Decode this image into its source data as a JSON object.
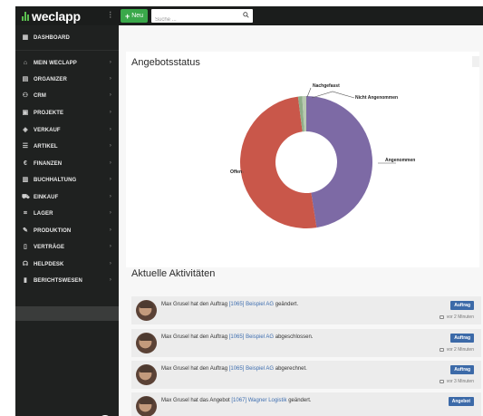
{
  "topbar": {
    "logo": "weclapp",
    "menu_toggle": "⁝",
    "new_label": "Neu",
    "search_placeholder": "Suche ..."
  },
  "sidebar": {
    "items": [
      {
        "label": "Dashboard",
        "icon": "dashboard-icon",
        "glyph": "▦",
        "chevron": false
      },
      {
        "label": "Mein weclapp",
        "icon": "home-icon",
        "glyph": "⌂",
        "chevron": true
      },
      {
        "label": "Organizer",
        "icon": "calendar-icon",
        "glyph": "▤",
        "chevron": true
      },
      {
        "label": "CRM",
        "icon": "users-icon",
        "glyph": "⚇",
        "chevron": true
      },
      {
        "label": "Projekte",
        "icon": "briefcase-icon",
        "glyph": "▣",
        "chevron": true
      },
      {
        "label": "Verkauf",
        "icon": "tag-icon",
        "glyph": "◈",
        "chevron": true
      },
      {
        "label": "Artikel",
        "icon": "list-icon",
        "glyph": "☰",
        "chevron": true
      },
      {
        "label": "Finanzen",
        "icon": "euro-icon",
        "glyph": "€",
        "chevron": true
      },
      {
        "label": "Buchhaltung",
        "icon": "ledger-icon",
        "glyph": "▥",
        "chevron": true
      },
      {
        "label": "Einkauf",
        "icon": "cart-icon",
        "glyph": "⛟",
        "chevron": true
      },
      {
        "label": "Lager",
        "icon": "warehouse-icon",
        "glyph": "⌗",
        "chevron": true
      },
      {
        "label": "Produktion",
        "icon": "wrench-icon",
        "glyph": "✎",
        "chevron": true
      },
      {
        "label": "Verträge",
        "icon": "document-icon",
        "glyph": "▯",
        "chevron": true
      },
      {
        "label": "Helpdesk",
        "icon": "headset-icon",
        "glyph": "☊",
        "chevron": true
      },
      {
        "label": "Berichtswesen",
        "icon": "bar-chart-icon",
        "glyph": "▮",
        "chevron": true
      }
    ],
    "collapse_glyph": "‹"
  },
  "main": {
    "status_title": "Angebotsstatus",
    "activities_title": "Aktuelle Aktivitäten",
    "activities": [
      {
        "prefix": "Max Grusel hat den Auftrag ",
        "link": "[1065] Beispiel AG",
        "suffix": " geändert.",
        "badge": "Auftrag",
        "time": "vor 2 Minuten"
      },
      {
        "prefix": "Max Grusel hat den Auftrag ",
        "link": "[1065] Beispiel AG",
        "suffix": " abgeschlossen.",
        "badge": "Auftrag",
        "time": "vor 2 Minuten"
      },
      {
        "prefix": "Max Grusel hat den Auftrag ",
        "link": "[1065] Beispiel AG",
        "suffix": " abgerechnet.",
        "badge": "Auftrag",
        "time": "vor 3 Minuten"
      },
      {
        "prefix": "Max Grusel hat das Angebot ",
        "link": "[1067] Wagner Logistik",
        "suffix": " geändert.",
        "badge": "Angebot",
        "time": ""
      }
    ]
  },
  "colors": {
    "brand_green": "#3aa84a",
    "offen": "#c9574a",
    "angenommen": "#7d6aa5",
    "nachgefasst": "#8fae8a",
    "nicht_angenommen": "#b8c9b0"
  },
  "chart_data": {
    "type": "pie",
    "title": "Angebotsstatus",
    "donut": true,
    "categories": [
      "Angenommen",
      "Offen",
      "Nachgefasst",
      "Nicht Angenommen"
    ],
    "values": [
      47.5,
      50.5,
      1.0,
      1.0
    ]
  }
}
